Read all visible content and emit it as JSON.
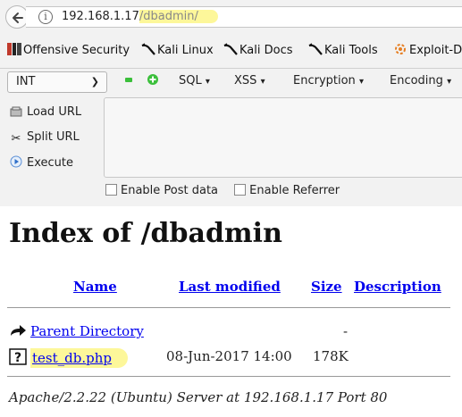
{
  "browser": {
    "url_base": "192.168.1.17",
    "url_path": "/dbadmin/"
  },
  "bookmarks": [
    {
      "label": "Offensive Security",
      "icon": "offsec-logo-icon"
    },
    {
      "label": "Kali Linux",
      "icon": "kali-dragon-icon"
    },
    {
      "label": "Kali Docs",
      "icon": "kali-dragon-icon"
    },
    {
      "label": "Kali Tools",
      "icon": "kali-dragon-icon"
    },
    {
      "label": "Exploit-D",
      "icon": "exploit-db-icon"
    }
  ],
  "hackbar": {
    "select_value": "INT",
    "menus": [
      "SQL",
      "XSS",
      "Encryption",
      "Encoding"
    ],
    "buttons": [
      "Load URL",
      "Split URL",
      "Execute"
    ],
    "checkboxes": [
      "Enable Post data",
      "Enable Referrer"
    ]
  },
  "page": {
    "title": "Index of /dbadmin",
    "columns": [
      "Name",
      "Last modified",
      "Size",
      "Description"
    ],
    "parent": {
      "name": "Parent Directory",
      "size": "-"
    },
    "file": {
      "name": "test_db.php",
      "modified": "08-Jun-2017 14:00",
      "size": "178K"
    },
    "address": "Apache/2.2.22 (Ubuntu) Server at 192.168.1.17 Port 80"
  },
  "colors": {
    "link": "#0000ee",
    "highlight": "#fdf79a",
    "chrome_bg": "#f2f2f2"
  }
}
